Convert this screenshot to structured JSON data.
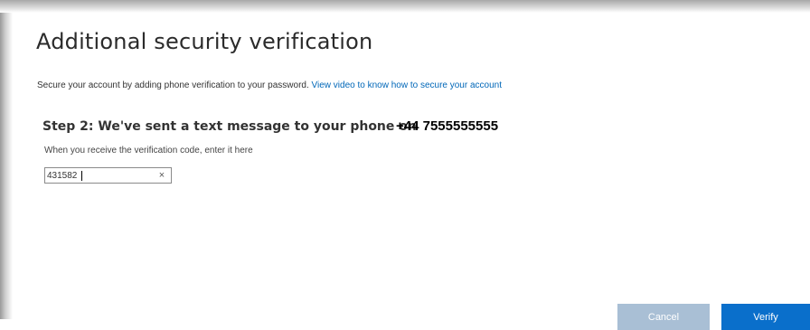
{
  "header": {
    "title": "Additional security verification"
  },
  "intro": {
    "text": "Secure your account by adding phone verification to your password.",
    "link_label": "View video to know how to secure your account"
  },
  "step": {
    "heading": "Step 2: We've sent a text message to your phone on",
    "phone_number": "+44 7555555555",
    "hint": "When you receive the verification code, enter it here"
  },
  "code_field": {
    "value": "431582",
    "clear_glyph": "×"
  },
  "actions": {
    "cancel_label": "Cancel",
    "verify_label": "Verify"
  },
  "colors": {
    "link": "#0067b8",
    "primary_button": "#0a6fcb",
    "disabled_button": "#a9bfd5"
  },
  "icons": {
    "clear": "close-icon"
  }
}
